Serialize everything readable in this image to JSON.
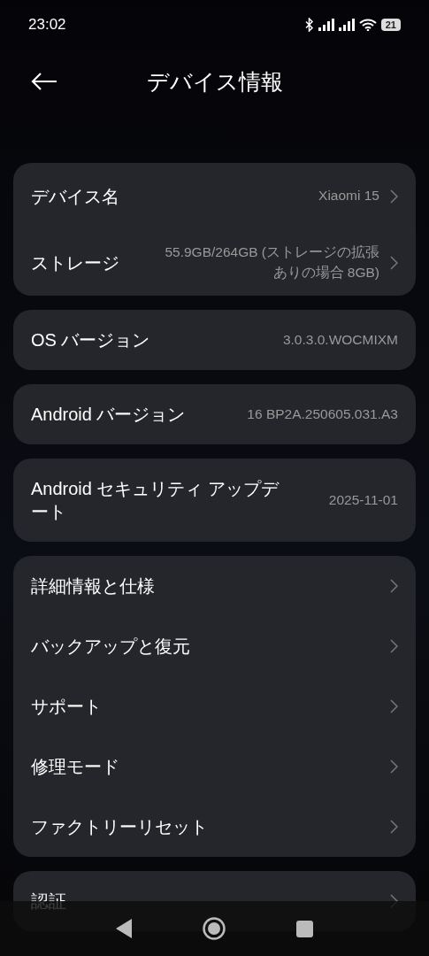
{
  "status_bar": {
    "time": "23:02",
    "battery": "21"
  },
  "header": {
    "title": "デバイス情報"
  },
  "groups": [
    {
      "rows": [
        {
          "label": "デバイス名",
          "value": "Xiaomi 15",
          "chevron": true
        },
        {
          "label": "ストレージ",
          "value": "55.9GB/264GB (ストレージの拡張ありの場合 8GB)",
          "chevron": true
        }
      ]
    },
    {
      "rows": [
        {
          "label": "OS バージョン",
          "value": "3.0.3.0.WOCMIXM",
          "chevron": false
        }
      ]
    },
    {
      "rows": [
        {
          "label": "Android バージョン",
          "value": "16 BP2A.250605.031.A3",
          "chevron": false
        }
      ]
    },
    {
      "rows": [
        {
          "label": "Android セキュリティ アップデート",
          "value": "2025-11-01",
          "chevron": false
        }
      ]
    },
    {
      "rows": [
        {
          "label": "詳細情報と仕様",
          "chevron": true
        },
        {
          "label": "バックアップと復元",
          "chevron": true
        },
        {
          "label": "サポート",
          "chevron": true
        },
        {
          "label": "修理モード",
          "chevron": true
        },
        {
          "label": "ファクトリーリセット",
          "chevron": true
        }
      ]
    },
    {
      "rows": [
        {
          "label": "認証",
          "chevron": true
        }
      ]
    }
  ]
}
